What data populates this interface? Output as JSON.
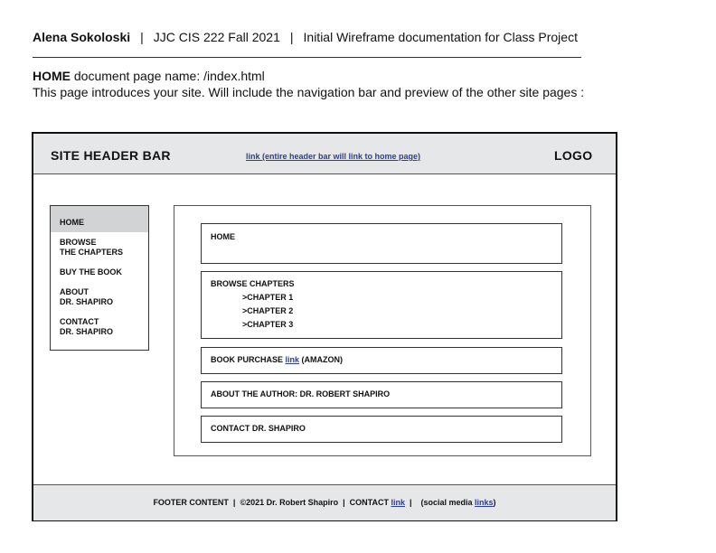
{
  "doc": {
    "author": "Alena Sokoloski",
    "course": "JJC CIS 222 Fall 2021",
    "description": "Initial Wireframe documentation for Class Project",
    "separator": "|",
    "page_label": "HOME",
    "page_name_text": "document page name: /index.html",
    "intro": "This page introduces your site. Will include the navigation bar and preview of the other site pages :"
  },
  "wireframe": {
    "header": {
      "title": "SITE HEADER BAR",
      "link_text": "link (entire header bar will link to home page)",
      "logo": "LOGO"
    },
    "nav": {
      "home": "HOME",
      "browse_line1": "BROWSE",
      "browse_line2": "THE CHAPTERS",
      "buy": "BUY THE BOOK",
      "about_line1": "ABOUT",
      "about_line2": "DR. SHAPIRO",
      "contact_line1": "CONTACT",
      "contact_line2": "DR. SHAPIRO"
    },
    "cards": {
      "home": "HOME",
      "browse": "BROWSE CHAPTERS",
      "chapter1": ">CHAPTER 1",
      "chapter2": ">CHAPTER 2",
      "chapter3": ">CHAPTER 3",
      "purchase_prefix": "BOOK PURCHASE ",
      "purchase_link": "link",
      "purchase_suffix": " (AMAZON)",
      "about": "ABOUT THE AUTHOR: DR. ROBERT SHAPIRO",
      "contact": "CONTACT DR. SHAPIRO"
    },
    "footer": {
      "prefix": "FOOTER CONTENT  |  ©2021 Dr. Robert Shapiro  |  CONTACT ",
      "contact_link": "link",
      "middle": "  |    (social media ",
      "social_link": "links",
      "suffix": ")"
    }
  }
}
